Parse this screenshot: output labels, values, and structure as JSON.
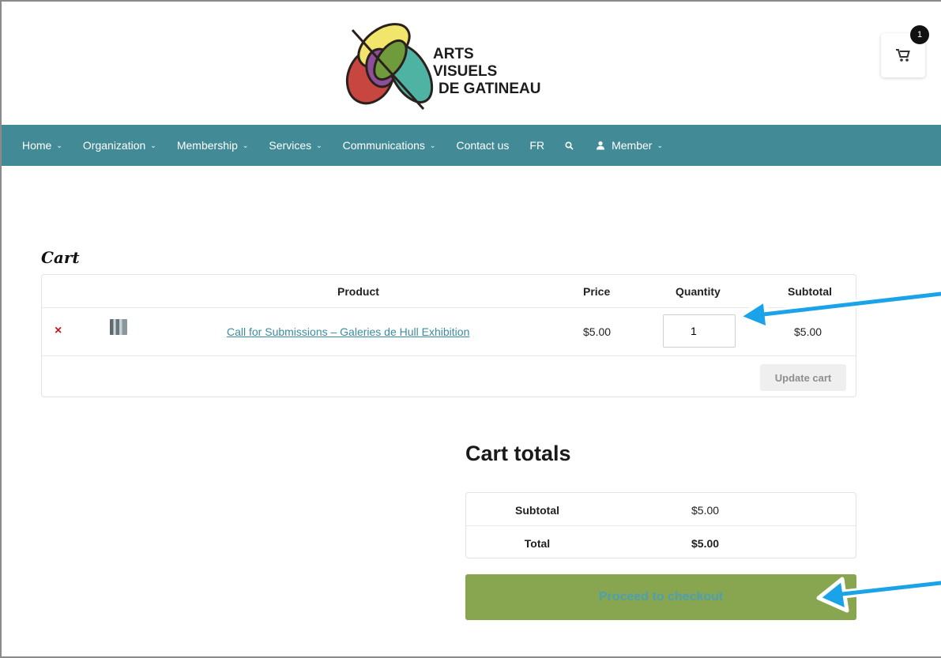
{
  "brand": {
    "line1": "ARTS",
    "line2": "VISUELS",
    "line3": "DE GATINEAU"
  },
  "cart_widget": {
    "count": "1",
    "icon": "shopping-cart-icon"
  },
  "nav": {
    "items": [
      {
        "label": "Home",
        "chevron": "⌄"
      },
      {
        "label": "Organization",
        "chevron": "⌄"
      },
      {
        "label": "Membership",
        "chevron": "⌄"
      },
      {
        "label": "Services",
        "chevron": "⌄"
      },
      {
        "label": "Communications",
        "chevron": "⌄"
      },
      {
        "label": "Contact us"
      },
      {
        "label": "FR"
      },
      {
        "label": "Member",
        "chevron": "⌄"
      }
    ],
    "search_icon": "search-icon",
    "user_icon": "user-icon"
  },
  "cart": {
    "title": "Cart",
    "headers": {
      "product": "Product",
      "price": "Price",
      "quantity": "Quantity",
      "subtotal": "Subtotal"
    },
    "items": [
      {
        "remove": "×",
        "name": "Call for Submissions – Galeries de Hull Exhibition",
        "price": "$5.00",
        "quantity": "1",
        "subtotal": "$5.00"
      }
    ],
    "update_label": "Update cart"
  },
  "totals": {
    "title": "Cart totals",
    "subtotal_label": "Subtotal",
    "subtotal_value": "$5.00",
    "total_label": "Total",
    "total_value": "$5.00",
    "checkout_label": "Proceed to checkout"
  },
  "colors": {
    "nav_bg": "#428a96",
    "checkout_bg": "#88a650",
    "link": "#3a8ca0",
    "annotation_arrow": "#1aa3e8"
  }
}
